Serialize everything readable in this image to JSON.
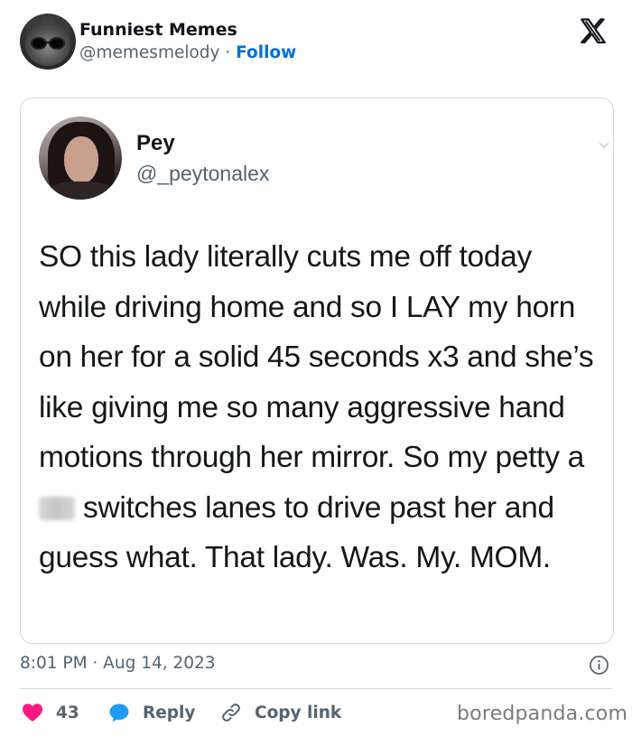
{
  "header": {
    "author_name": "Funniest Memes",
    "author_handle": "@memesmelody",
    "separator": " · ",
    "follow_label": "Follow",
    "logo_icon": "x-logo-icon"
  },
  "embedded_post": {
    "name": "Pey",
    "handle": "@_peytonalex",
    "text_before_blur": "SO this lady literally cuts me off today while driving home and so I LAY my horn on her for a solid 45 seconds x3 and she’s like giving me so many aggressive hand motions through her mirror. So my petty a",
    "text_after_blur": " switches lanes to drive past her and guess what. That lady. Was. My. MOM."
  },
  "footer": {
    "timestamp": "8:01 PM · Aug 14, 2023",
    "like_count": "43",
    "reply_label": "Reply",
    "copy_link_label": "Copy link",
    "watermark": "boredpanda.com"
  },
  "colors": {
    "follow_blue": "#006fd6",
    "like_red": "#f91880",
    "reply_blue": "#1d9bf0",
    "muted": "#536471"
  }
}
